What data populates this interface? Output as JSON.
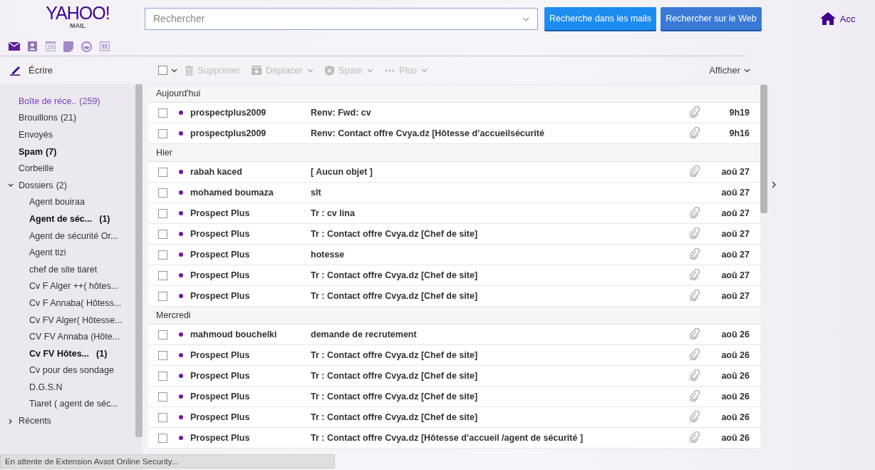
{
  "logo": {
    "brand": "YAHOO!",
    "product": "MAIL"
  },
  "search": {
    "placeholder": "Rechercher"
  },
  "search_buttons": [
    "Recherche dans les mails",
    "Rechercher sur le Web"
  ],
  "home": {
    "label": "Acc"
  },
  "apps": [
    {
      "kind": "mail",
      "selected": true
    },
    {
      "kind": "contacts",
      "selected": false
    },
    {
      "kind": "calendar",
      "label": "28",
      "selected": false
    },
    {
      "kind": "notepad",
      "selected": false
    },
    {
      "kind": "messenger",
      "selected": false
    },
    {
      "kind": "newsfeed",
      "selected": false
    }
  ],
  "compose": {
    "label": "Écrire"
  },
  "folders": [
    {
      "label": "Boîte de réce..",
      "count": "(259)",
      "selected": true,
      "unread": false
    },
    {
      "label": "Brouillons",
      "count": "(21)",
      "selected": false,
      "unread": false
    },
    {
      "label": "Envoyés",
      "selected": false,
      "unread": false
    },
    {
      "label": "Spam",
      "count": "(7)",
      "selected": false,
      "unread": true
    },
    {
      "label": "Corbeille",
      "selected": false,
      "unread": false
    },
    {
      "label": "Dossiers",
      "count": "(2)",
      "expanded": true,
      "selected": false,
      "unread": false,
      "children": [
        {
          "label": "Agent bouiraa",
          "selected": false,
          "unread": false
        },
        {
          "label": "Agent de séc...",
          "count": "(1)",
          "selected": false,
          "unread": true
        },
        {
          "label": "Agent de sécurité Or...",
          "selected": false,
          "unread": false
        },
        {
          "label": "Agent tizi",
          "selected": false,
          "unread": false
        },
        {
          "label": "chef de site tiaret",
          "selected": false,
          "unread": false
        },
        {
          "label": "Cv F Alger ++( hôtes...",
          "selected": false,
          "unread": false
        },
        {
          "label": "Cv F Annaba( Hôtess...",
          "selected": false,
          "unread": false
        },
        {
          "label": "Cv FV Alger( Hôtesse...",
          "selected": false,
          "unread": false
        },
        {
          "label": "CV FV Annaba (Hôte...",
          "selected": false,
          "unread": false
        },
        {
          "label": "Cv FV Hôtes...",
          "count": "(1)",
          "selected": false,
          "unread": true
        },
        {
          "label": "Cv pour des sondage",
          "selected": false,
          "unread": false
        },
        {
          "label": "D.G.S.N",
          "selected": false,
          "unread": false
        },
        {
          "label": "Tiaret ( agent de séc...",
          "selected": false,
          "unread": false
        }
      ]
    },
    {
      "label": "Récents",
      "expanded": false,
      "selected": false,
      "unread": false
    }
  ],
  "toolbar": {
    "select_all": {
      "checked": false
    },
    "actions": [
      {
        "kind": "delete",
        "label": "Supprimer",
        "menu": false
      },
      {
        "kind": "move",
        "label": "Déplacer",
        "menu": true
      },
      {
        "kind": "spam",
        "label": "Spam",
        "menu": true
      },
      {
        "kind": "more",
        "label": "Plus",
        "menu": true
      }
    ],
    "view": "Afficher"
  },
  "groups": [
    {
      "title": "Aujourd'hui",
      "messages": [
        {
          "sender": "prospectplus2009",
          "subject": "Renv: Fwd: cv",
          "attachment": true,
          "date": "9h19",
          "unread": true,
          "checked": false
        },
        {
          "sender": "prospectplus2009",
          "subject": "Renv: Contact offre Cvya.dz [Hôtesse d’accueilsécurité",
          "attachment": true,
          "date": "9h16",
          "unread": true,
          "checked": false
        }
      ]
    },
    {
      "title": "Hier",
      "messages": [
        {
          "sender": "rabah kaced",
          "subject": "[ Aucun objet ]",
          "attachment": true,
          "date": "aoû 27",
          "unread": true,
          "checked": false
        },
        {
          "sender": "mohamed boumaza",
          "subject": "slt",
          "attachment": false,
          "date": "aoû 27",
          "unread": true,
          "checked": false
        },
        {
          "sender": "Prospect Plus",
          "subject": "Tr : cv lina",
          "attachment": true,
          "date": "aoû 27",
          "unread": true,
          "checked": false
        },
        {
          "sender": "Prospect Plus",
          "subject": "Tr : Contact offre Cvya.dz [Chef de site]",
          "attachment": true,
          "date": "aoû 27",
          "unread": true,
          "checked": false
        },
        {
          "sender": "Prospect Plus",
          "subject": "hotesse",
          "attachment": true,
          "date": "aoû 27",
          "unread": true,
          "checked": false
        },
        {
          "sender": "Prospect Plus",
          "subject": "Tr : Contact offre Cvya.dz [Chef de site]",
          "attachment": true,
          "date": "aoû 27",
          "unread": true,
          "checked": false
        },
        {
          "sender": "Prospect Plus",
          "subject": "Tr : Contact offre Cvya.dz [Chef de site]",
          "attachment": true,
          "date": "aoû 27",
          "unread": true,
          "checked": false
        }
      ]
    },
    {
      "title": "Mercredi",
      "messages": [
        {
          "sender": "mahmoud bouchelki",
          "subject": "demande de recrutement",
          "attachment": true,
          "date": "aoû 26",
          "unread": true,
          "checked": false
        },
        {
          "sender": "Prospect Plus",
          "subject": "Tr : Contact offre Cvya.dz [Chef de site]",
          "attachment": true,
          "date": "aoû 26",
          "unread": true,
          "checked": false
        },
        {
          "sender": "Prospect Plus",
          "subject": "Tr : Contact offre Cvya.dz [Chef de site]",
          "attachment": true,
          "date": "aoû 26",
          "unread": true,
          "checked": false
        },
        {
          "sender": "Prospect Plus",
          "subject": "Tr : Contact offre Cvya.dz [Chef de site]",
          "attachment": true,
          "date": "aoû 26",
          "unread": true,
          "checked": false
        },
        {
          "sender": "Prospect Plus",
          "subject": "Tr : Contact offre Cvya.dz [Chef de site]",
          "attachment": true,
          "date": "aoû 26",
          "unread": true,
          "checked": false
        },
        {
          "sender": "Prospect Plus",
          "subject": "Tr : Contact offre Cvya.dz [Hôtesse d’accueil /agent de sécurité ]",
          "attachment": true,
          "date": "aoû 26",
          "unread": true,
          "checked": false
        }
      ]
    }
  ],
  "status_bar": {
    "text": "En attente de Extension Avast Online Security..."
  }
}
